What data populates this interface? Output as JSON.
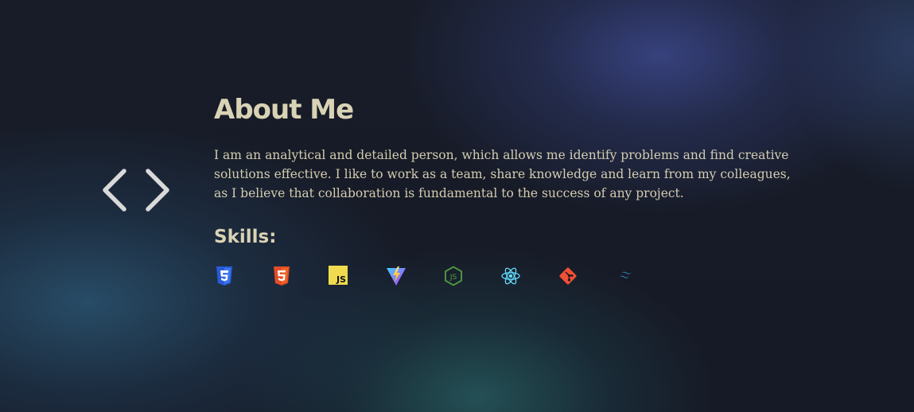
{
  "about": {
    "title": "About Me",
    "text": "I am an analytical and detailed person, which allows me identify problems and find creative solutions effective. I like to work as a team, share knowledge and learn from my colleagues, as I believe that collaboration is fundamental to the success of any project."
  },
  "skills": {
    "title": "Skills:",
    "items": [
      {
        "icon": "css3-icon",
        "color": "#2a5bd7"
      },
      {
        "icon": "html5-icon",
        "color": "#e44d26"
      },
      {
        "icon": "javascript-icon",
        "label": "JS",
        "color": "#f0db4f"
      },
      {
        "icon": "vite-icon",
        "color": "#a259ff"
      },
      {
        "icon": "nodejs-icon",
        "label": "JS",
        "color": "#539e43"
      },
      {
        "icon": "react-icon",
        "color": "#61dafb"
      },
      {
        "icon": "git-icon",
        "color": "#f05033"
      },
      {
        "icon": "tailwind-icon",
        "color": "#38bdf8"
      }
    ]
  },
  "colors": {
    "text": "#d8d2b4",
    "background": "#171b27",
    "code_icon": "#d9d9d9"
  },
  "decor": {
    "code_icon": "code-brackets-icon"
  }
}
